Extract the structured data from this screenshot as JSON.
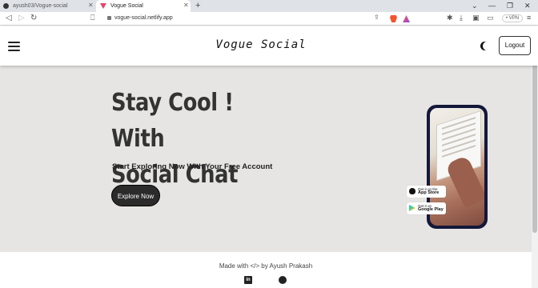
{
  "browser": {
    "tabs": [
      {
        "title": "ayush03/Vogue-social",
        "active": false
      },
      {
        "title": "Vogue Social",
        "active": true
      }
    ],
    "url": "vogue-social.netlify.app",
    "vpn_label": "• VPN"
  },
  "header": {
    "brand": "Vogue Social",
    "logout_label": "Logout"
  },
  "hero": {
    "title_line1": "Stay Cool ! With",
    "title_line2": "Social Chat",
    "subtitle": "Start Exploring Now With Your Free Account",
    "cta_label": "Explore Now",
    "app_store": {
      "small": "Get it on the",
      "big": "App Store"
    },
    "google_play": {
      "small": "Get it on",
      "big": "Google Play"
    }
  },
  "footer": {
    "credit": "Made with </> by Ayush Prakash",
    "linkedin_glyph": "in"
  },
  "colors": {
    "hero_bg": "#e7e5e3",
    "cta_bg": "#2b2b2b",
    "phone_frame": "#14183a"
  }
}
